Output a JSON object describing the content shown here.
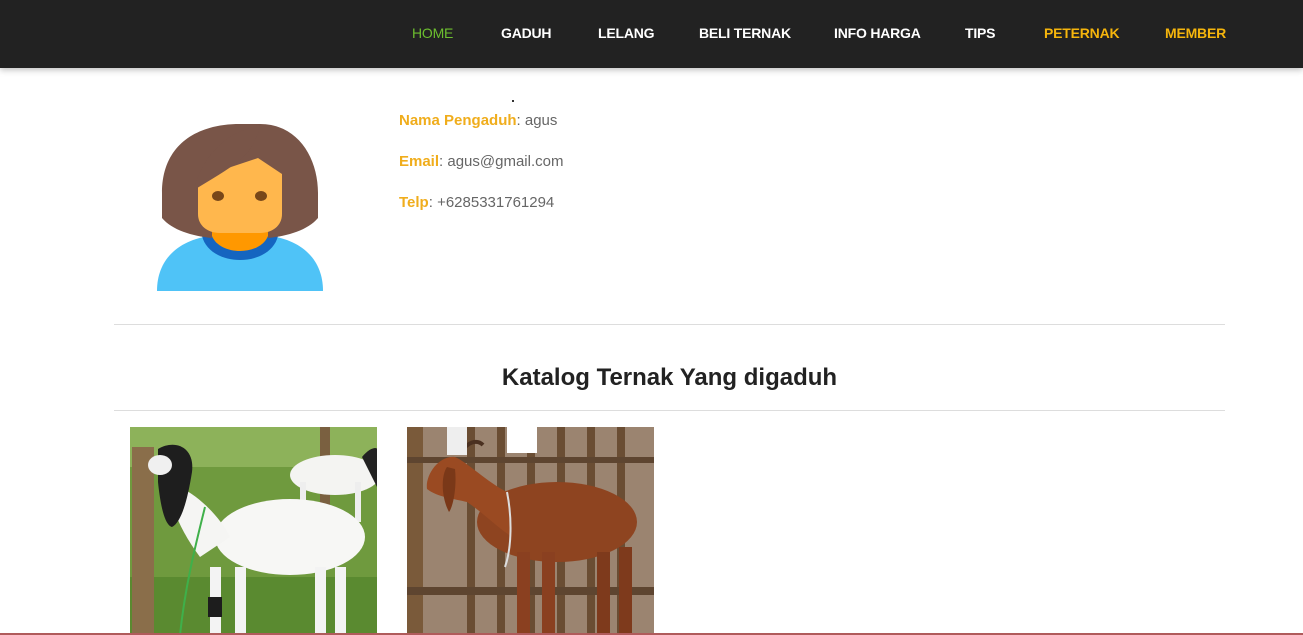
{
  "nav": {
    "items": [
      {
        "label": "HOME"
      },
      {
        "label": "GADUH"
      },
      {
        "label": "LELANG"
      },
      {
        "label": "BELI TERNAK"
      },
      {
        "label": "INFO HARGA"
      },
      {
        "label": "TIPS"
      },
      {
        "label": "PETERNAK"
      },
      {
        "label": "MEMBER"
      }
    ]
  },
  "profile": {
    "name_label": "Nama Pengaduh",
    "name_value": ": agus",
    "email_label": "Email",
    "email_value": ": agus@gmail.com",
    "phone_label": "Telp",
    "phone_value": ": +6285331761294"
  },
  "catalog": {
    "title": "Katalog Ternak Yang digaduh",
    "items": [
      {
        "image": "white-goat-photo"
      },
      {
        "image": "brown-goat-photo"
      }
    ]
  },
  "colors": {
    "navbar_bg": "#222222",
    "active_nav": "#6dbf2f",
    "highlight_nav": "#f5b50c",
    "label_accent": "#f0ad1c"
  }
}
